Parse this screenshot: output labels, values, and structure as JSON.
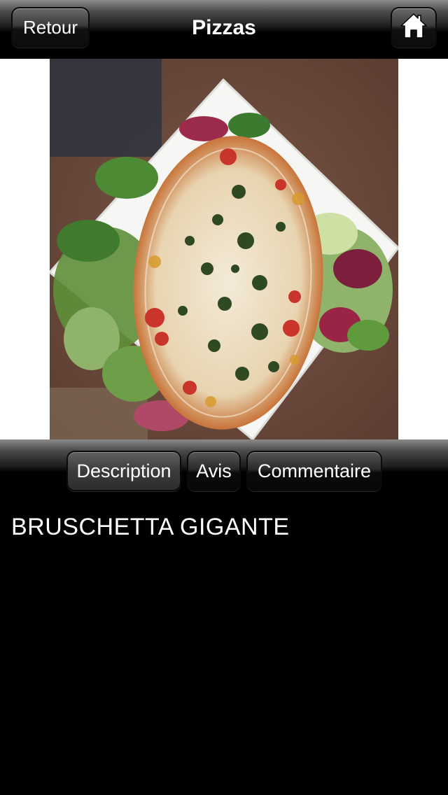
{
  "header": {
    "back_label": "Retour",
    "title": "Pizzas",
    "home_icon": "home-icon"
  },
  "photo": {
    "subject": "bruschetta-photo"
  },
  "tabs": [
    {
      "label": "Description",
      "active": true
    },
    {
      "label": "Avis",
      "active": false
    },
    {
      "label": "Commentaire",
      "active": false
    }
  ],
  "content": {
    "item_name": "BRUSCHETTA GIGANTE"
  },
  "colors": {
    "background": "#000000",
    "text": "#ffffff",
    "photo_frame": "#ffffff"
  }
}
